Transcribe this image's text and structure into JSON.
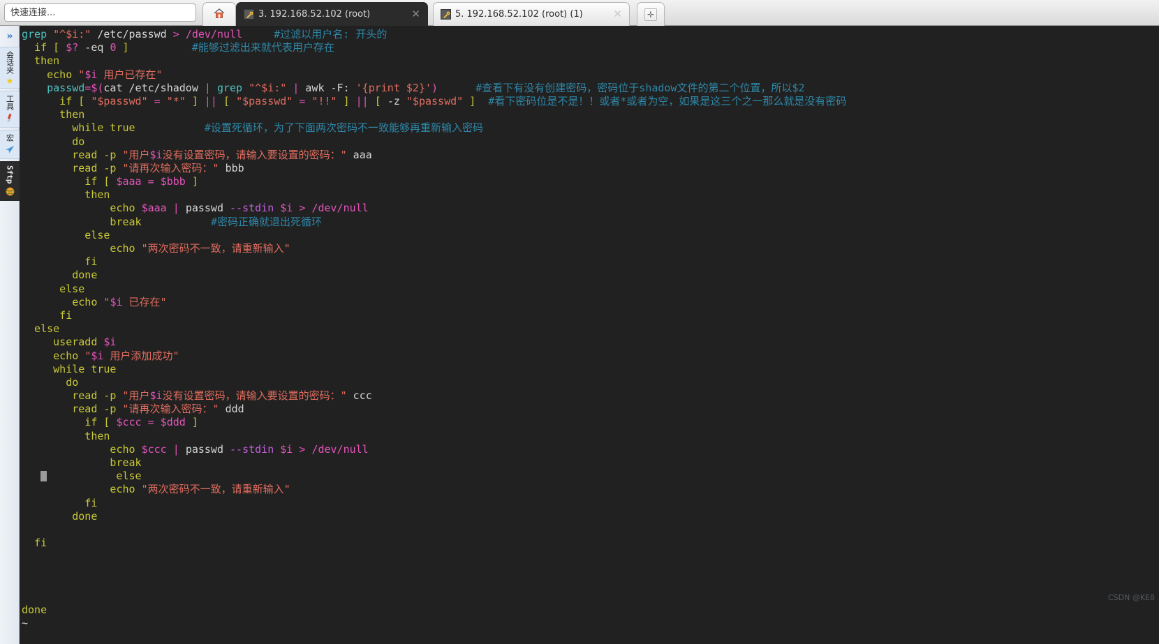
{
  "window": {
    "quick_connect_placeholder": "快速连接..."
  },
  "tabs": {
    "home_icon": "home-icon",
    "items": [
      {
        "icon": "terminal-key-icon",
        "label": "3. 192.168.52.102 (root)",
        "close": "✕",
        "active": true
      },
      {
        "icon": "terminal-key-icon",
        "label": "5. 192.168.52.102 (root) (1)",
        "close": "✕",
        "active": false
      }
    ],
    "new_tab_label": "✛"
  },
  "sidebar": {
    "expand_glyph": "»",
    "items": [
      {
        "label": "会话夹",
        "icon": "star-icon",
        "icon_glyph": "★",
        "icon_color": "#f5c518",
        "selected": false
      },
      {
        "label": "工具",
        "icon": "knife-icon",
        "icon_glyph": "🔪",
        "icon_color": "#d04a3a",
        "selected": false
      },
      {
        "label": "宏",
        "icon": "paper-plane-icon",
        "icon_glyph": "➤",
        "icon_color": "#5aa7e8",
        "selected": false
      },
      {
        "label": "Sftp",
        "icon": "globe-icon",
        "icon_glyph": "●",
        "icon_color": "#f0a030",
        "selected": true
      }
    ]
  },
  "terminal": {
    "background": "#212121",
    "colors": {
      "command": "#4fc1c1",
      "keyword": "#c8c838",
      "string": "#e06c5e",
      "variable": "#e255b9",
      "comment": "#2e87a8",
      "option": "#c060d8",
      "plain": "#d6d6d6",
      "path": "#e255b9",
      "builtin": "#d8d8d8"
    },
    "cursor_row": 33,
    "lines": [
      {
        "indent": 0,
        "tokens": [
          {
            "t": "grep ",
            "c": "command"
          },
          {
            "t": "\"^$i:\"",
            "c": "string"
          },
          {
            "t": " /etc/passwd ",
            "c": "plain"
          },
          {
            "t": "> ",
            "c": "variable"
          },
          {
            "t": "/dev/null",
            "c": "variable"
          },
          {
            "t": "     ",
            "c": "plain"
          },
          {
            "t": "#过滤以用户名: 开头的",
            "c": "comment"
          }
        ]
      },
      {
        "indent": 0,
        "tokens": [
          {
            "t": "  if ",
            "c": "keyword"
          },
          {
            "t": "[ ",
            "c": "keyword"
          },
          {
            "t": "$?",
            "c": "variable"
          },
          {
            "t": " -eq ",
            "c": "plain"
          },
          {
            "t": "0",
            "c": "variable"
          },
          {
            "t": " ]",
            "c": "keyword"
          },
          {
            "t": "          ",
            "c": "plain"
          },
          {
            "t": "#能够过滤出来就代表用户存在",
            "c": "comment"
          }
        ]
      },
      {
        "indent": 0,
        "tokens": [
          {
            "t": "  then",
            "c": "keyword"
          }
        ]
      },
      {
        "indent": 0,
        "tokens": [
          {
            "t": "    echo ",
            "c": "keyword"
          },
          {
            "t": "\"",
            "c": "string"
          },
          {
            "t": "$i",
            "c": "variable"
          },
          {
            "t": " 用户已存在\"",
            "c": "string"
          }
        ]
      },
      {
        "indent": 0,
        "tokens": [
          {
            "t": "    passwd",
            "c": "command"
          },
          {
            "t": "=",
            "c": "variable"
          },
          {
            "t": "$(",
            "c": "variable"
          },
          {
            "t": "cat /etc/shadow ",
            "c": "plain"
          },
          {
            "t": "| ",
            "c": "variable"
          },
          {
            "t": "grep ",
            "c": "command"
          },
          {
            "t": "\"^$i:\"",
            "c": "string"
          },
          {
            "t": " ",
            "c": "plain"
          },
          {
            "t": "| ",
            "c": "variable"
          },
          {
            "t": "awk -F: ",
            "c": "plain"
          },
          {
            "t": "'{print $2}'",
            "c": "string"
          },
          {
            "t": ")",
            "c": "variable"
          },
          {
            "t": "      ",
            "c": "plain"
          },
          {
            "t": "#查看下有没有创建密码，密码位于shadow文件的第二个位置，所以$2",
            "c": "comment"
          }
        ]
      },
      {
        "indent": 0,
        "tokens": [
          {
            "t": "      if ",
            "c": "keyword"
          },
          {
            "t": "[ ",
            "c": "keyword"
          },
          {
            "t": "\"$passwd\"",
            "c": "string"
          },
          {
            "t": " = ",
            "c": "variable"
          },
          {
            "t": "\"*\"",
            "c": "string"
          },
          {
            "t": " ]",
            "c": "keyword"
          },
          {
            "t": " || ",
            "c": "variable"
          },
          {
            "t": "[ ",
            "c": "keyword"
          },
          {
            "t": "\"$passwd\"",
            "c": "string"
          },
          {
            "t": " = ",
            "c": "variable"
          },
          {
            "t": "\"!!\"",
            "c": "string"
          },
          {
            "t": " ]",
            "c": "keyword"
          },
          {
            "t": " || ",
            "c": "variable"
          },
          {
            "t": "[ ",
            "c": "keyword"
          },
          {
            "t": "-z ",
            "c": "plain"
          },
          {
            "t": "\"$passwd\"",
            "c": "string"
          },
          {
            "t": " ]",
            "c": "keyword"
          },
          {
            "t": "  ",
            "c": "plain"
          },
          {
            "t": "#看下密码位是不是！！或者*或者为空，如果是这三个之一那么就是没有密码",
            "c": "comment"
          }
        ]
      },
      {
        "indent": 0,
        "tokens": [
          {
            "t": "      then",
            "c": "keyword"
          }
        ]
      },
      {
        "indent": 0,
        "tokens": [
          {
            "t": "        while true",
            "c": "keyword"
          },
          {
            "t": "           ",
            "c": "plain"
          },
          {
            "t": "#设置死循环，为了下面两次密码不一致能够再重新输入密码",
            "c": "comment"
          }
        ]
      },
      {
        "indent": 0,
        "tokens": [
          {
            "t": "        do",
            "c": "keyword"
          }
        ]
      },
      {
        "indent": 0,
        "tokens": [
          {
            "t": "        read ",
            "c": "keyword"
          },
          {
            "t": "-p ",
            "c": "keyword"
          },
          {
            "t": "\"用户",
            "c": "string"
          },
          {
            "t": "$i",
            "c": "variable"
          },
          {
            "t": "没有设置密码，请输入要设置的密码：\"",
            "c": "string"
          },
          {
            "t": " aaa",
            "c": "plain"
          }
        ]
      },
      {
        "indent": 0,
        "tokens": [
          {
            "t": "        read ",
            "c": "keyword"
          },
          {
            "t": "-p ",
            "c": "keyword"
          },
          {
            "t": "\"请再次输入密码：\"",
            "c": "string"
          },
          {
            "t": " bbb",
            "c": "plain"
          }
        ]
      },
      {
        "indent": 0,
        "tokens": [
          {
            "t": "          if ",
            "c": "keyword"
          },
          {
            "t": "[ ",
            "c": "keyword"
          },
          {
            "t": "$aaa",
            "c": "variable"
          },
          {
            "t": " = ",
            "c": "variable"
          },
          {
            "t": "$bbb",
            "c": "variable"
          },
          {
            "t": " ]",
            "c": "keyword"
          }
        ]
      },
      {
        "indent": 0,
        "tokens": [
          {
            "t": "          then",
            "c": "keyword"
          }
        ]
      },
      {
        "indent": 0,
        "tokens": [
          {
            "t": "              echo ",
            "c": "keyword"
          },
          {
            "t": "$aaa",
            "c": "variable"
          },
          {
            "t": " ",
            "c": "plain"
          },
          {
            "t": "| ",
            "c": "variable"
          },
          {
            "t": "passwd ",
            "c": "plain"
          },
          {
            "t": "--stdin ",
            "c": "option"
          },
          {
            "t": "$i",
            "c": "variable"
          },
          {
            "t": " ",
            "c": "plain"
          },
          {
            "t": "> ",
            "c": "variable"
          },
          {
            "t": "/dev/null",
            "c": "variable"
          }
        ]
      },
      {
        "indent": 0,
        "tokens": [
          {
            "t": "              break",
            "c": "keyword"
          },
          {
            "t": "           ",
            "c": "plain"
          },
          {
            "t": "#密码正确就退出死循环",
            "c": "comment"
          }
        ]
      },
      {
        "indent": 0,
        "tokens": [
          {
            "t": "          else",
            "c": "keyword"
          }
        ]
      },
      {
        "indent": 0,
        "tokens": [
          {
            "t": "              echo ",
            "c": "keyword"
          },
          {
            "t": "\"两次密码不一致，请重新输入\"",
            "c": "string"
          }
        ]
      },
      {
        "indent": 0,
        "tokens": [
          {
            "t": "          fi",
            "c": "keyword"
          }
        ]
      },
      {
        "indent": 0,
        "tokens": [
          {
            "t": "        done",
            "c": "keyword"
          }
        ]
      },
      {
        "indent": 0,
        "tokens": [
          {
            "t": "      else",
            "c": "keyword"
          }
        ]
      },
      {
        "indent": 0,
        "tokens": [
          {
            "t": "        echo ",
            "c": "keyword"
          },
          {
            "t": "\"",
            "c": "string"
          },
          {
            "t": "$i",
            "c": "variable"
          },
          {
            "t": " 已存在\"",
            "c": "string"
          }
        ]
      },
      {
        "indent": 0,
        "tokens": [
          {
            "t": "      fi",
            "c": "keyword"
          }
        ]
      },
      {
        "indent": 0,
        "tokens": [
          {
            "t": "  else",
            "c": "keyword"
          }
        ]
      },
      {
        "indent": 0,
        "tokens": [
          {
            "t": "     useradd ",
            "c": "keyword"
          },
          {
            "t": "$i",
            "c": "variable"
          }
        ]
      },
      {
        "indent": 0,
        "tokens": [
          {
            "t": "     echo ",
            "c": "keyword"
          },
          {
            "t": "\"",
            "c": "string"
          },
          {
            "t": "$i",
            "c": "variable"
          },
          {
            "t": " 用户添加成功\"",
            "c": "string"
          }
        ]
      },
      {
        "indent": 0,
        "tokens": [
          {
            "t": "     while true",
            "c": "keyword"
          }
        ]
      },
      {
        "indent": 0,
        "tokens": [
          {
            "t": "       do",
            "c": "keyword"
          }
        ]
      },
      {
        "indent": 0,
        "tokens": [
          {
            "t": "        read ",
            "c": "keyword"
          },
          {
            "t": "-p ",
            "c": "keyword"
          },
          {
            "t": "\"用户",
            "c": "string"
          },
          {
            "t": "$i",
            "c": "variable"
          },
          {
            "t": "没有设置密码，请输入要设置的密码：\"",
            "c": "string"
          },
          {
            "t": " ccc",
            "c": "plain"
          }
        ]
      },
      {
        "indent": 0,
        "tokens": [
          {
            "t": "        read ",
            "c": "keyword"
          },
          {
            "t": "-p ",
            "c": "keyword"
          },
          {
            "t": "\"请再次输入密码：\"",
            "c": "string"
          },
          {
            "t": " ddd",
            "c": "plain"
          }
        ]
      },
      {
        "indent": 0,
        "tokens": [
          {
            "t": "          if ",
            "c": "keyword"
          },
          {
            "t": "[ ",
            "c": "keyword"
          },
          {
            "t": "$ccc",
            "c": "variable"
          },
          {
            "t": " = ",
            "c": "variable"
          },
          {
            "t": "$ddd",
            "c": "variable"
          },
          {
            "t": " ]",
            "c": "keyword"
          }
        ]
      },
      {
        "indent": 0,
        "tokens": [
          {
            "t": "          then",
            "c": "keyword"
          }
        ]
      },
      {
        "indent": 0,
        "tokens": [
          {
            "t": "              echo ",
            "c": "keyword"
          },
          {
            "t": "$ccc",
            "c": "variable"
          },
          {
            "t": " ",
            "c": "plain"
          },
          {
            "t": "| ",
            "c": "variable"
          },
          {
            "t": "passwd ",
            "c": "plain"
          },
          {
            "t": "--stdin ",
            "c": "option"
          },
          {
            "t": "$i",
            "c": "variable"
          },
          {
            "t": " ",
            "c": "plain"
          },
          {
            "t": "> ",
            "c": "variable"
          },
          {
            "t": "/dev/null",
            "c": "variable"
          }
        ]
      },
      {
        "indent": 0,
        "tokens": [
          {
            "t": "              break",
            "c": "keyword"
          }
        ]
      },
      {
        "indent": 0,
        "cursor": true,
        "cursor_col": 3,
        "tokens": [
          {
            "t": "          else",
            "c": "keyword"
          }
        ]
      },
      {
        "indent": 0,
        "tokens": [
          {
            "t": "              echo ",
            "c": "keyword"
          },
          {
            "t": "\"两次密码不一致，请重新输入\"",
            "c": "string"
          }
        ]
      },
      {
        "indent": 0,
        "tokens": [
          {
            "t": "          fi",
            "c": "keyword"
          }
        ]
      },
      {
        "indent": 0,
        "tokens": [
          {
            "t": "        done",
            "c": "keyword"
          }
        ]
      },
      {
        "indent": 0,
        "tokens": [
          {
            "t": "",
            "c": "plain"
          }
        ]
      },
      {
        "indent": 0,
        "tokens": [
          {
            "t": "  fi",
            "c": "keyword"
          }
        ]
      },
      {
        "indent": 0,
        "tokens": [
          {
            "t": "",
            "c": "plain"
          }
        ]
      },
      {
        "indent": 0,
        "tokens": [
          {
            "t": "",
            "c": "plain"
          }
        ]
      },
      {
        "indent": 0,
        "tokens": [
          {
            "t": "",
            "c": "plain"
          }
        ]
      },
      {
        "indent": 0,
        "tokens": [
          {
            "t": "",
            "c": "plain"
          }
        ]
      },
      {
        "indent": 0,
        "tokens": [
          {
            "t": "done",
            "c": "keyword"
          }
        ]
      },
      {
        "indent": 0,
        "tokens": [
          {
            "t": "~",
            "c": "plain"
          }
        ]
      }
    ]
  },
  "watermark": "CSDN @KE8"
}
